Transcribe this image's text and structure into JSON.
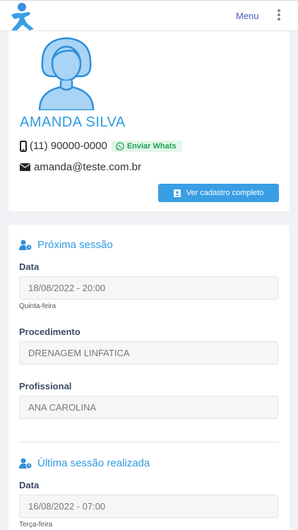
{
  "header": {
    "menu_label": "Menu"
  },
  "profile": {
    "name": "AMANDA SILVA",
    "phone": "(11) 90000-0000",
    "whats_label": "Enviar Whats",
    "email": "amanda@teste.com.br",
    "view_button_label": "Ver cadastro completo"
  },
  "next_session": {
    "title": "Próxima sessão",
    "date_label": "Data",
    "date_value": "18/08/2022 - 20:00",
    "weekday": "Quinta-feira",
    "procedure_label": "Procedimento",
    "procedure_value": "DRENAGEM LINFATICA",
    "professional_label": "Profissional",
    "professional_value": "ANA CAROLINA"
  },
  "last_session": {
    "title": "Última sessão realizada",
    "date_label": "Data",
    "date_value": "16/08/2022 - 07:00",
    "weekday": "Terça-feira"
  },
  "colors": {
    "accent": "#2e9be0",
    "button": "#3a9ee4",
    "whats": "#20a152"
  }
}
